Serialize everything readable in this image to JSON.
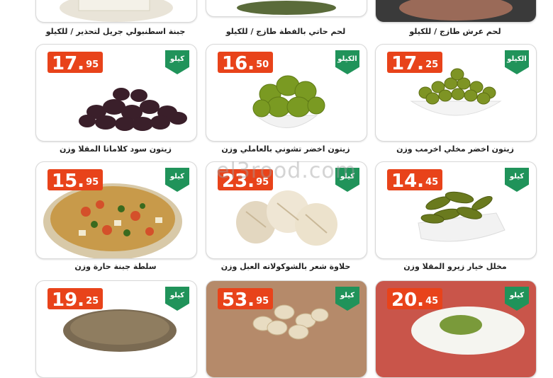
{
  "watermark": "el3rood.com",
  "top_row_captions": [
    "جبنة اسطنبولي جريل لتحذير / للكيلو",
    "لحم حاتي بالفطة طازج / للكيلو",
    "لحم عرش طازج / للكيلو"
  ],
  "products": [
    {
      "price_int": "17.",
      "price_dec": "95",
      "badge": "كيلو",
      "caption": "زيتون سود كلاماتا المقلا وزن"
    },
    {
      "price_int": "16.",
      "price_dec": "50",
      "badge": "الكيلو",
      "caption": "زيتون اخضر تشوني بالعاملي وزن"
    },
    {
      "price_int": "17.",
      "price_dec": "25",
      "badge": "الكيلو",
      "caption": "زيتون اخضر مخلي اخرمب وزن"
    },
    {
      "price_int": "15.",
      "price_dec": "95",
      "badge": "كيلو",
      "caption": "سلطة جبنة حارة وزن"
    },
    {
      "price_int": "23.",
      "price_dec": "95",
      "badge": "كيلو",
      "caption": "حلاوة شعر بالشوكولاته العبل وزن"
    },
    {
      "price_int": "14.",
      "price_dec": "45",
      "badge": "كيلو",
      "caption": "مخلل خيار زيرو المقلا وزن"
    },
    {
      "price_int": "19.",
      "price_dec": "25",
      "badge": "كيلو",
      "caption": ""
    },
    {
      "price_int": "53.",
      "price_dec": "95",
      "badge": "كيلو",
      "caption": ""
    },
    {
      "price_int": "20.",
      "price_dec": "45",
      "badge": "كيلو",
      "caption": ""
    }
  ]
}
